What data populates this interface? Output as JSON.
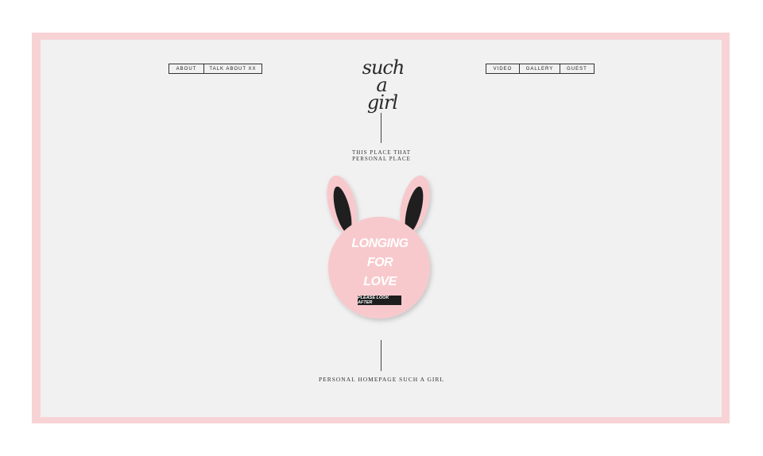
{
  "nav_left": [
    {
      "label": "ABOUT"
    },
    {
      "label": "TALK ABOUT XX"
    }
  ],
  "nav_right": [
    {
      "label": "VIDEO"
    },
    {
      "label": "GALLERY"
    },
    {
      "label": "GUEST"
    }
  ],
  "logo": {
    "line1": "such",
    "line2": "a",
    "line3": "girl"
  },
  "tagline": {
    "line1": "THIS PLACE THAT",
    "line2": "PERSONAL PLACE"
  },
  "badge": {
    "line1": "LONGING",
    "line2": "FOR",
    "line3": "LOVE",
    "cta": "PLEASE LOOK AFTER"
  },
  "footer": {
    "text": "PERSONAL HOMEPAGE SUCH A GIRL"
  },
  "colors": {
    "frame": "#f8d3d6",
    "background": "#f1f1f1",
    "bunny_pink": "#f7c9cd",
    "ear_inner": "#1f1f1f"
  }
}
